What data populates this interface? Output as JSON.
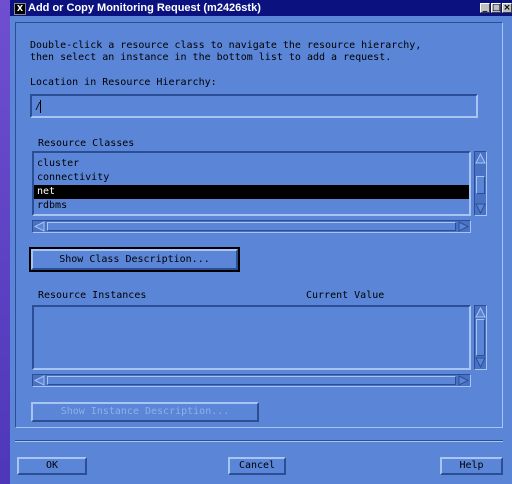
{
  "window": {
    "title": "Add or Copy Monitoring Request (m2426stk)",
    "icon": "x-icon",
    "controls": [
      "minimize",
      "maximize",
      "close"
    ]
  },
  "instructions": {
    "line1": "Double-click a resource class to navigate the resource hierarchy,",
    "line2": "then select an instance in the bottom list to add a request."
  },
  "location": {
    "label": "Location in Resource Hierarchy:",
    "value": "/"
  },
  "resource_classes": {
    "label": "Resource Classes",
    "items": [
      "cluster",
      "connectivity",
      "net",
      "rdbms"
    ],
    "selected": "net"
  },
  "buttons": {
    "show_class_description": "Show Class Description...",
    "show_instance_description": "Show Instance Description...",
    "ok": "OK",
    "cancel": "Cancel",
    "help": "Help"
  },
  "resource_instances": {
    "label": "Resource Instances",
    "value_label": "Current Value",
    "items": []
  }
}
